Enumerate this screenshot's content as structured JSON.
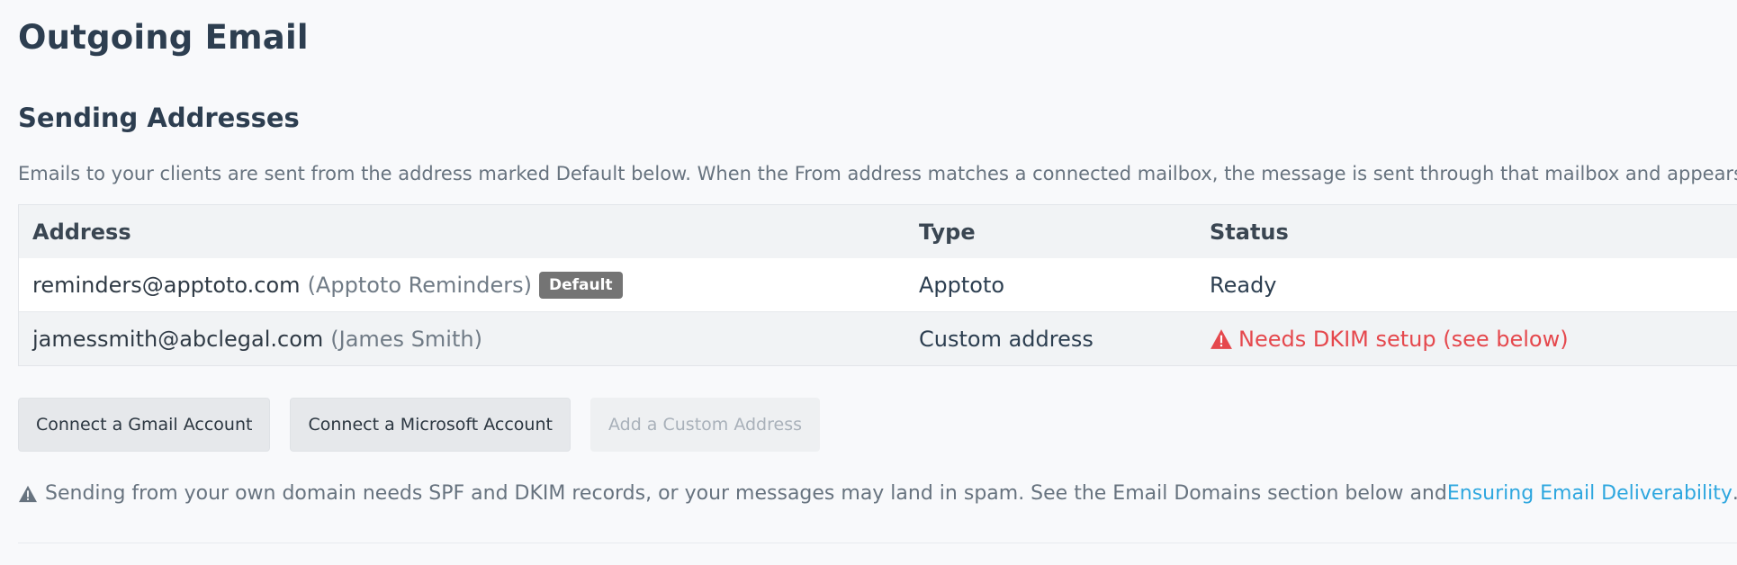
{
  "page": {
    "title": "Outgoing Email"
  },
  "sending": {
    "title": "Sending Addresses",
    "intro": "Emails to your clients are sent from the address marked Default below. When the From address matches a connected mailbox, the message is sent through that mailbox and appears"
  },
  "table": {
    "headers": {
      "address": "Address",
      "type": "Type",
      "status": "Status"
    },
    "rows": [
      {
        "address": "reminders@apptoto.com",
        "name": "(Apptoto Reminders)",
        "badge": "Default",
        "type": "Apptoto",
        "status": "Ready"
      },
      {
        "address": "jamessmith@abclegal.com",
        "name": "(James Smith)",
        "type": "Custom address",
        "status": "Needs DKIM setup (see below)"
      }
    ]
  },
  "buttons": {
    "gmail": "Connect a Gmail Account",
    "microsoft": "Connect a Microsoft Account",
    "custom": "Add a Custom Address"
  },
  "note": {
    "text": "Sending from your own domain needs SPF and DKIM records, or your messages may land in spam. See the Email Domains section below and ",
    "link": "Ensuring Email Deliverability",
    "tail": "."
  },
  "colors": {
    "warning": "#e5484d",
    "link": "#2ea7df",
    "badge": "#747474"
  },
  "icons": {
    "warning": "warning-triangle-icon"
  }
}
